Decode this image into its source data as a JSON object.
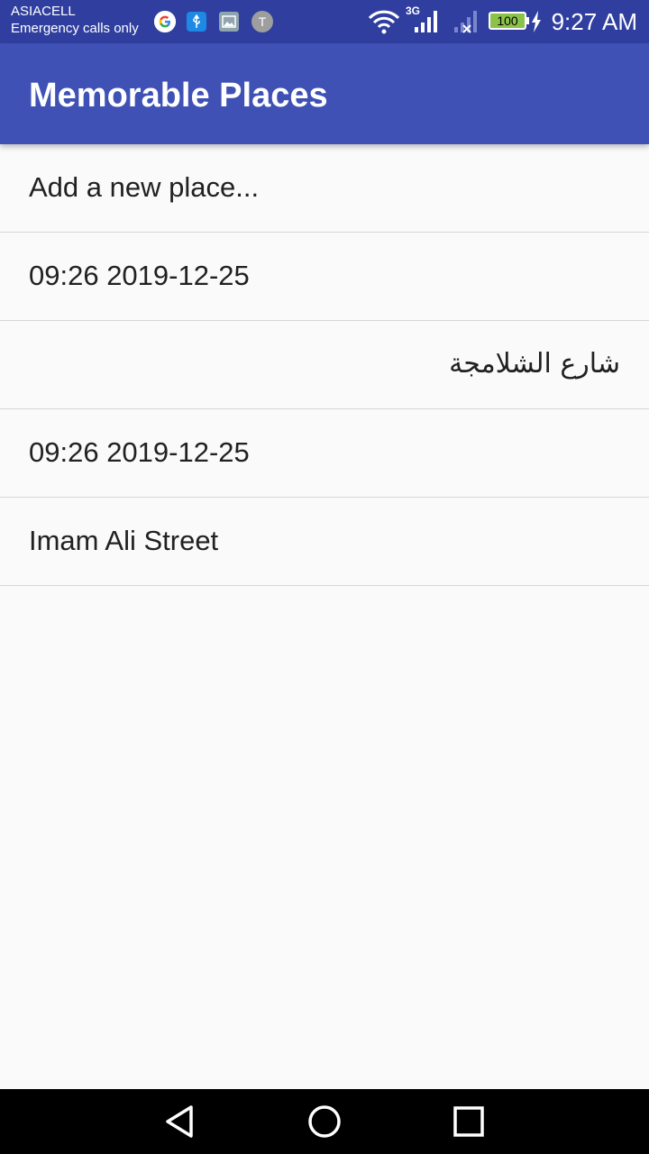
{
  "status": {
    "carrier": "ASIACELL",
    "carrier_sub": "Emergency calls only",
    "network_type": "3G",
    "battery_level": "100",
    "time": "9:27 AM",
    "notifications": [
      "google-icon",
      "usb-icon",
      "image-icon",
      "t-icon"
    ],
    "t_icon_letter": "T"
  },
  "appbar": {
    "title": "Memorable Places",
    "color": "#3f51b5",
    "status_color": "#303f9f"
  },
  "list": {
    "items": [
      {
        "label": "Add a new place..."
      },
      {
        "label": "09:26 2019-12-25"
      },
      {
        "label": "شارع الشلامجة"
      },
      {
        "label": "09:26 2019-12-25"
      },
      {
        "label": "Imam Ali Street"
      }
    ]
  },
  "navbar": {
    "buttons": [
      "back-icon",
      "home-icon",
      "recents-icon"
    ]
  }
}
